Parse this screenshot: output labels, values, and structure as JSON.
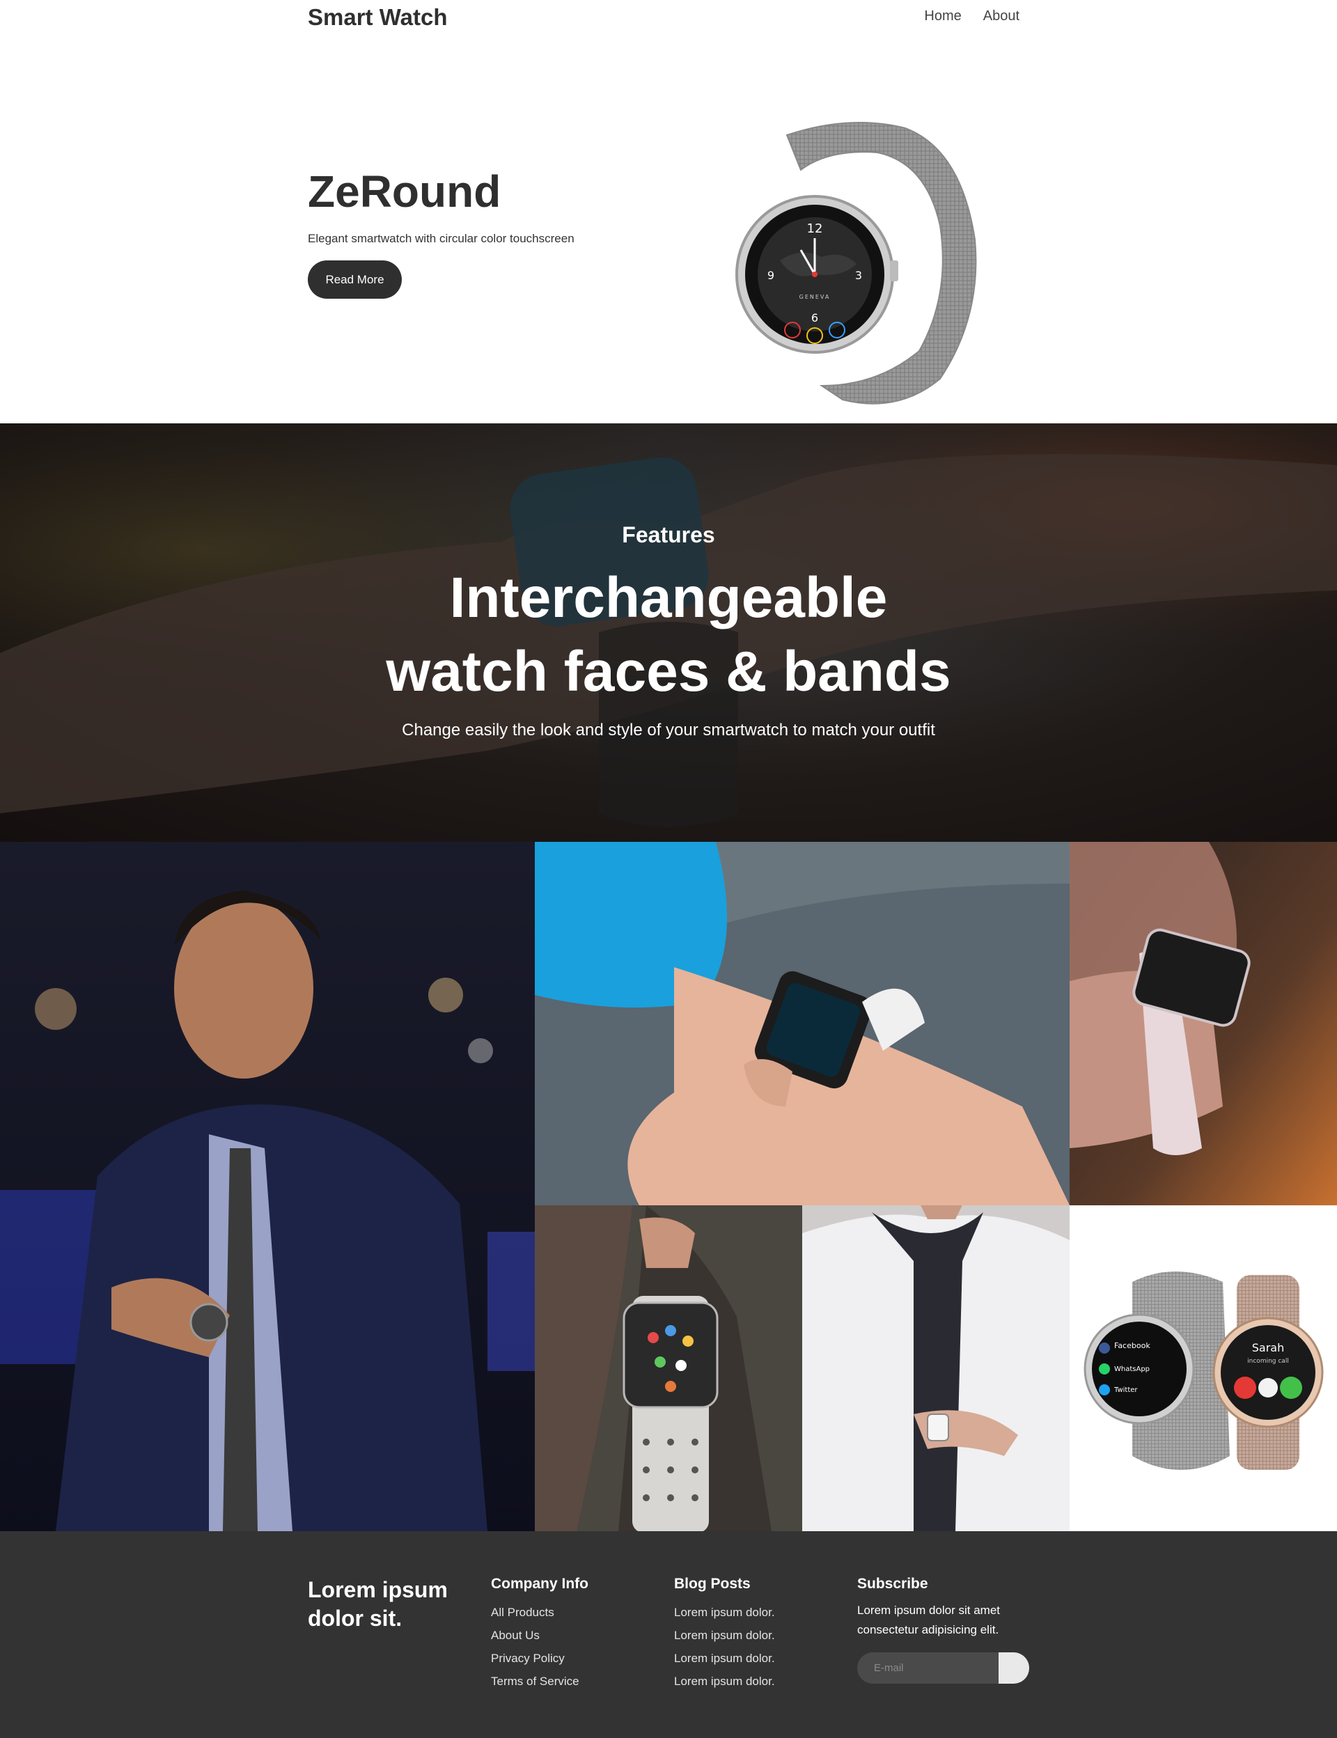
{
  "header": {
    "brand": "Smart Watch",
    "nav": [
      {
        "label": "Home"
      },
      {
        "label": "About"
      }
    ]
  },
  "hero": {
    "title": "ZeRound",
    "subtitle": "Elegant smartwatch with circular color touchscreen",
    "button": "Read More",
    "watch": {
      "dial_numbers": [
        "12",
        "3",
        "6",
        "9"
      ],
      "dial_text": "GENEVA"
    }
  },
  "features": {
    "label": "Features",
    "title_line1": "Interchangeable",
    "title_line2": "watch faces & bands",
    "subtitle": "Change easily the look and style of your smartwatch to match your outfit"
  },
  "gallery": {
    "product_watch": {
      "notifications": [
        "Facebook",
        "WhatsApp",
        "Twitter"
      ],
      "caller": "Sarah",
      "call_status": "incoming call"
    }
  },
  "footer": {
    "brand": "Lorem ipsum dolor sit.",
    "company": {
      "heading": "Company Info",
      "links": [
        "All Products",
        "About Us",
        "Privacy Policy",
        "Terms of Service"
      ]
    },
    "blog": {
      "heading": "Blog Posts",
      "links": [
        "Lorem ipsum dolor.",
        "Lorem ipsum dolor.",
        "Lorem ipsum dolor.",
        "Lorem ipsum dolor."
      ]
    },
    "subscribe": {
      "heading": "Subscribe",
      "text": "Lorem ipsum dolor sit amet consectetur adipisicing elit.",
      "placeholder": "E-mail"
    }
  },
  "colors": {
    "dark": "#2f2f2f",
    "footer_bg": "#333333",
    "white": "#ffffff"
  }
}
